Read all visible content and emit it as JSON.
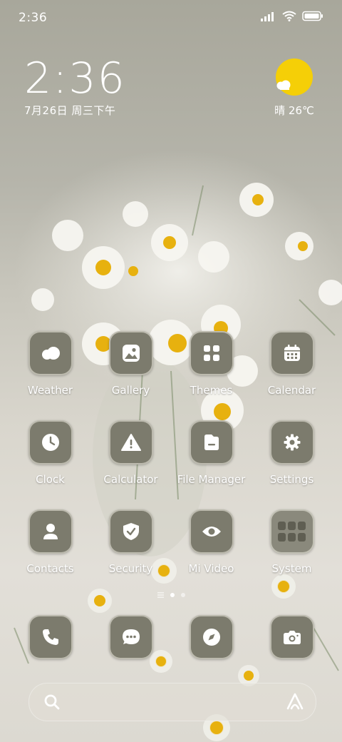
{
  "status_bar": {
    "time": "2:36"
  },
  "clock_widget": {
    "time": "2:36",
    "date": "7月26日 周三下午"
  },
  "weather_widget": {
    "condition": "晴",
    "temperature": "26℃",
    "label": "晴 26℃"
  },
  "apps": [
    {
      "label": "Weather",
      "icon": "cloud-icon"
    },
    {
      "label": "Gallery",
      "icon": "image-icon"
    },
    {
      "label": "Themes",
      "icon": "grid-squares-icon"
    },
    {
      "label": "Calendar",
      "icon": "calendar-icon"
    },
    {
      "label": "Clock",
      "icon": "clock-icon"
    },
    {
      "label": "Calculator",
      "icon": "warning-triangle-icon"
    },
    {
      "label": "File Manager",
      "icon": "folder-icon"
    },
    {
      "label": "Settings",
      "icon": "gear-icon"
    },
    {
      "label": "Contacts",
      "icon": "person-icon"
    },
    {
      "label": "Security",
      "icon": "shield-check-icon"
    },
    {
      "label": "Mi Video",
      "icon": "eye-icon"
    },
    {
      "label": "System",
      "icon": "folder-grid-icon"
    }
  ],
  "dock": [
    {
      "icon": "phone-icon"
    },
    {
      "icon": "message-icon"
    },
    {
      "icon": "compass-icon"
    },
    {
      "icon": "camera-icon"
    }
  ],
  "pages": {
    "count": 3,
    "active": 2
  },
  "colors": {
    "icon_bg": "#7c7b6d",
    "icon_glyph": "#ffffff",
    "sun": "#f5cf07"
  }
}
